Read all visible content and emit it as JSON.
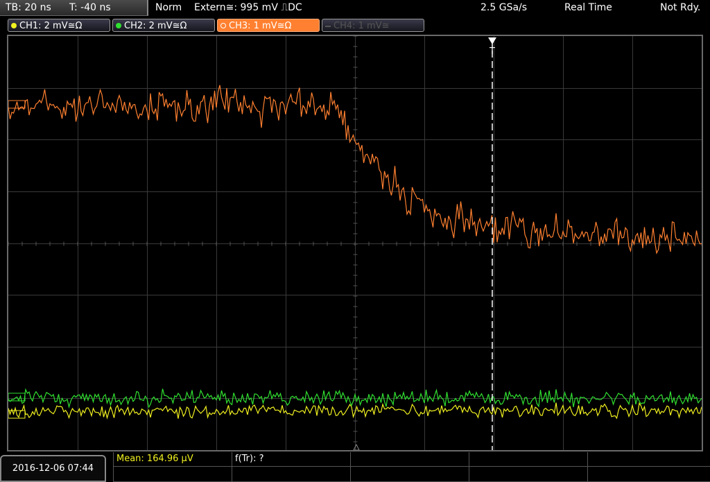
{
  "status_bar": {
    "timebase": "TB: 20 ns",
    "trigger_time": "T: -40 ns",
    "trigger_mode": "Norm",
    "trigger_source": "Extern≅: 995 mV ⎍DC",
    "sample_rate": "2.5 GSa/s",
    "acq_mode": "Real Time",
    "status": "Not Rdy."
  },
  "channels": [
    {
      "label": "CH1: 2 mV≅Ω",
      "color": "#f0f020",
      "active": true
    },
    {
      "label": "CH2: 2 mV≅Ω",
      "color": "#30e030",
      "active": true
    },
    {
      "label": "CH3: 1 mV≅Ω",
      "color": "#ff8030",
      "active": true,
      "selected": true
    },
    {
      "label": "CH4: 1 mV≅",
      "color": "#606060",
      "active": false
    }
  ],
  "trigger_marker": "T",
  "datetime": "2016-12-06 07:44",
  "measurements": {
    "mean": "Mean: 164.96 µV",
    "rise_time": "f(Tr): ?"
  },
  "colors": {
    "ch1": "#f0f020",
    "ch2": "#30e030",
    "ch3": "#ff8030",
    "ch3_tab_bg": "#ff8030",
    "grid": "#3a3a3a"
  },
  "chart_data": {
    "type": "line",
    "grid": true,
    "x_divisions": 10,
    "y_divisions": 8,
    "series": [
      {
        "channel": "CH3",
        "shape": "noisy step: high level before center, falling around center, low level after"
      },
      {
        "channel": "CH2",
        "shape": "noise near baseline"
      },
      {
        "channel": "CH1",
        "shape": "noise near baseline"
      }
    ]
  }
}
